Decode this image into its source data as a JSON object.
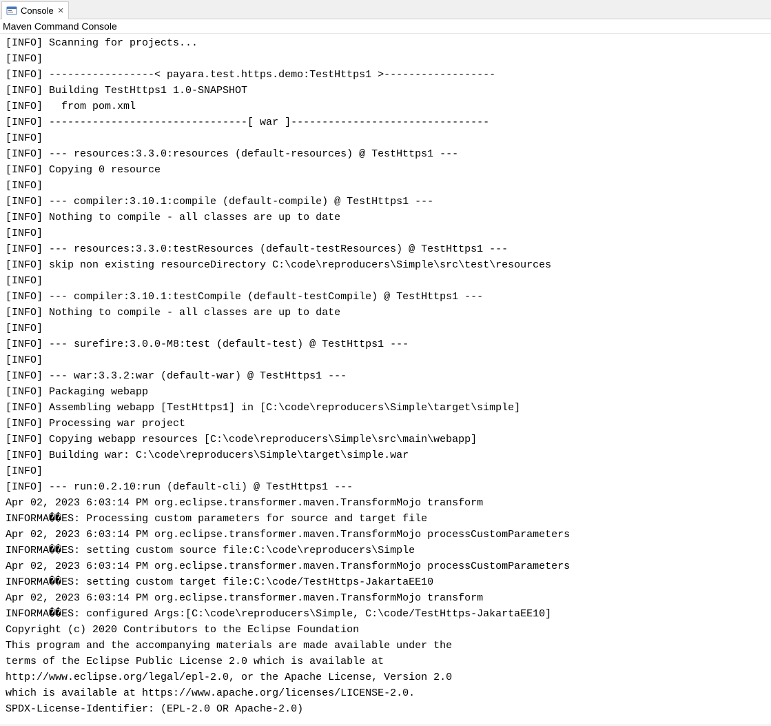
{
  "tab": {
    "label": "Console"
  },
  "header": {
    "title": "Maven Command Console"
  },
  "console": {
    "lines": [
      "[INFO] Scanning for projects...",
      "[INFO]",
      "[INFO] -----------------< payara.test.https.demo:TestHttps1 >------------------",
      "[INFO] Building TestHttps1 1.0-SNAPSHOT",
      "[INFO]   from pom.xml",
      "[INFO] --------------------------------[ war ]--------------------------------",
      "[INFO]",
      "[INFO] --- resources:3.3.0:resources (default-resources) @ TestHttps1 ---",
      "[INFO] Copying 0 resource",
      "[INFO]",
      "[INFO] --- compiler:3.10.1:compile (default-compile) @ TestHttps1 ---",
      "[INFO] Nothing to compile - all classes are up to date",
      "[INFO]",
      "[INFO] --- resources:3.3.0:testResources (default-testResources) @ TestHttps1 ---",
      "[INFO] skip non existing resourceDirectory C:\\code\\reproducers\\Simple\\src\\test\\resources",
      "[INFO]",
      "[INFO] --- compiler:3.10.1:testCompile (default-testCompile) @ TestHttps1 ---",
      "[INFO] Nothing to compile - all classes are up to date",
      "[INFO]",
      "[INFO] --- surefire:3.0.0-M8:test (default-test) @ TestHttps1 ---",
      "[INFO]",
      "[INFO] --- war:3.3.2:war (default-war) @ TestHttps1 ---",
      "[INFO] Packaging webapp",
      "[INFO] Assembling webapp [TestHttps1] in [C:\\code\\reproducers\\Simple\\target\\simple]",
      "[INFO] Processing war project",
      "[INFO] Copying webapp resources [C:\\code\\reproducers\\Simple\\src\\main\\webapp]",
      "[INFO] Building war: C:\\code\\reproducers\\Simple\\target\\simple.war",
      "[INFO]",
      "[INFO] --- run:0.2.10:run (default-cli) @ TestHttps1 ---",
      "Apr 02, 2023 6:03:14 PM org.eclipse.transformer.maven.TransformMojo transform",
      "INFORMA��ES: Processing custom parameters for source and target file",
      "Apr 02, 2023 6:03:14 PM org.eclipse.transformer.maven.TransformMojo processCustomParameters",
      "INFORMA��ES: setting custom source file:C:\\code\\reproducers\\Simple",
      "Apr 02, 2023 6:03:14 PM org.eclipse.transformer.maven.TransformMojo processCustomParameters",
      "INFORMA��ES: setting custom target file:C:\\code/TestHttps-JakartaEE10",
      "Apr 02, 2023 6:03:14 PM org.eclipse.transformer.maven.TransformMojo transform",
      "INFORMA��ES: configured Args:[C:\\code\\reproducers\\Simple, C:\\code/TestHttps-JakartaEE10]",
      "Copyright (c) 2020 Contributors to the Eclipse Foundation",
      "This program and the accompanying materials are made available under the",
      "terms of the Eclipse Public License 2.0 which is available at",
      "http://www.eclipse.org/legal/epl-2.0, or the Apache License, Version 2.0",
      "which is available at https://www.apache.org/licenses/LICENSE-2.0.",
      "SPDX-License-Identifier: (EPL-2.0 OR Apache-2.0)"
    ]
  }
}
